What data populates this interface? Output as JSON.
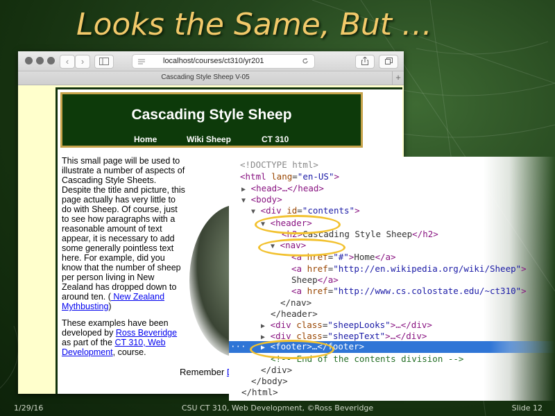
{
  "slide": {
    "title": "Looks the Same, But …",
    "footer_left": "1/29/16",
    "footer_center": "CSU CT 310, Web Development, ©Ross Beveridge",
    "footer_right": "Slide 12"
  },
  "browser": {
    "url": "localhost/courses/ct310/yr201",
    "tab_title": "Cascading Style Sheep V-05",
    "new_tab": "+",
    "back": "‹",
    "forward": "›"
  },
  "site": {
    "title": "Cascading Style Sheep",
    "nav": [
      "Home",
      "Wiki Sheep",
      "CT 310"
    ],
    "p1": "This small page will be used to illustrate a number of aspects of Cascading Style Sheets. Despite the title and picture, this page actually has very little to do with Sheep. Of course, just to see how paragraphs with a reasonable amount of text appear, it is necessary to add some generally pointless text here. For example, did you know that the number of sheep per person living in New Zealand has dropped down to around ten. (",
    "p1_link": " New Zealand Mythbusting",
    "p1_end": ")",
    "p2_a": "These examples have been developed by ",
    "p2_link1": "Ross Beveridge",
    "p2_b": " as part of the ",
    "p2_link2": "CT 310, Web Development",
    "p2_c": ", course.",
    "remember": "Remember ",
    "remember_link": "D"
  },
  "devtools": {
    "doctype": "<!DOCTYPE html>",
    "html_open": "<html ",
    "html_attr": "lang",
    "html_val": "\"en-US\"",
    "html_close": ">",
    "head": "<head>…</head>",
    "body_open": "<body>",
    "div_open": "<div ",
    "div_attr": "id",
    "div_val": "\"contents\"",
    "div_close": ">",
    "header_open": "<header>",
    "h2_open": "<h2>",
    "h2_text": "Cascading Style Sheep",
    "h2_close": "</h2>",
    "nav_open": "<nav>",
    "a1_open": "<a ",
    "a1_attr": "href",
    "a1_val": "\"#\"",
    "a1_mid": ">",
    "a1_text": "Home",
    "a1_close": "</a>",
    "a2_open": "<a ",
    "a2_attr": "href",
    "a2_val": "\"http://en.wikipedia.org/wiki/Sheep\"",
    "a2_mid": ">",
    "a2_text": "Sheep",
    "a2_close": "</a>",
    "a3_open": "<a ",
    "a3_attr": "href",
    "a3_val": "\"http://www.cs.colostate.edu/~ct310\"",
    "a3_mid": ">",
    "nav_close": "</nav>",
    "header_close": "</header>",
    "div2_open": "<div ",
    "div2_attr": "class",
    "div2_val": "\"sheepLooks\"",
    "div2_rest": ">…</div>",
    "div3_open": "<div ",
    "div3_attr": "class",
    "div3_val": "\"sheepText\"",
    "div3_rest": ">…</div>",
    "dots": "···",
    "footer": "<footer>…</footer>",
    "comment": "<!-- End of the contents division -->",
    "div_end": "</div>",
    "body_end": "</body>",
    "html_end": "</html>"
  },
  "icons": {
    "sidebar": "sidebar-icon",
    "reload": "reload-icon",
    "share": "share-icon",
    "tabs": "tabs-icon",
    "reader": "reader-icon"
  },
  "colors": {
    "title": "#f2c96a",
    "site_header_bg": "#0d3a0a",
    "site_header_border": "#c5a24a",
    "highlight_circle": "#f2c12e",
    "devtools_selection": "#2f75d6"
  }
}
